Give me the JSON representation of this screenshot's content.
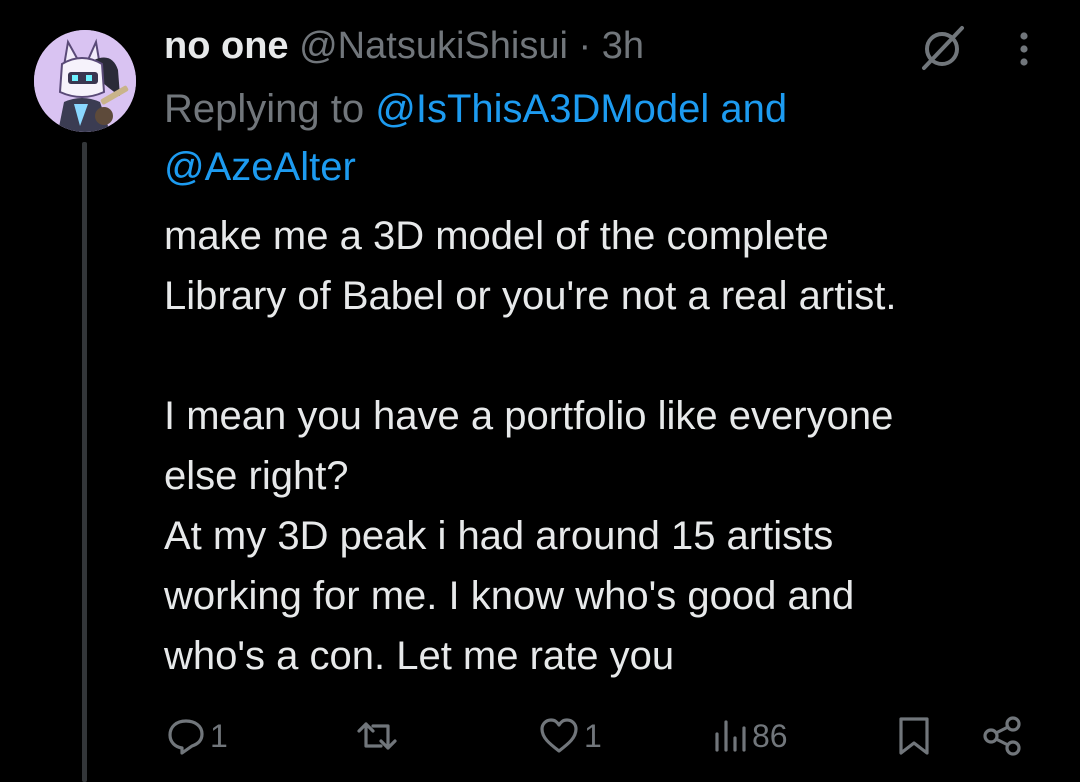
{
  "tweet": {
    "display_name": "no one",
    "handle": "@NatsukiShisui",
    "separator": "·",
    "time": "3h",
    "replying_prefix": "Replying to",
    "replying_mention_1": "@IsThisA3DModel",
    "replying_conjunction": "and",
    "replying_mention_2": "@AzeAlter",
    "body_lines": [
      "make me a 3D model of the complete",
      "Library of Babel or you're not a real artist.",
      "",
      "I mean you have a portfolio like everyone",
      "else right?",
      "At my 3D peak i had around 15 artists",
      "working for me. I know who's good and",
      "who's a con. Let me rate you"
    ]
  },
  "actions": {
    "reply_count": "1",
    "retweet_count": "",
    "like_count": "1",
    "views_count": "86"
  },
  "icons": {
    "reply": "reply-icon",
    "retweet": "retweet-icon",
    "like": "heart-icon",
    "views": "views-bar-chart-icon",
    "bookmark": "bookmark-icon",
    "share": "share-icon",
    "grok": "grok-slash-icon",
    "more": "more-vertical-icon"
  },
  "colors": {
    "background": "#000000",
    "primary_text": "#e7e9ea",
    "secondary_text": "#71767b",
    "link": "#1d9bf0",
    "avatar_bg": "#d9c3f2"
  }
}
